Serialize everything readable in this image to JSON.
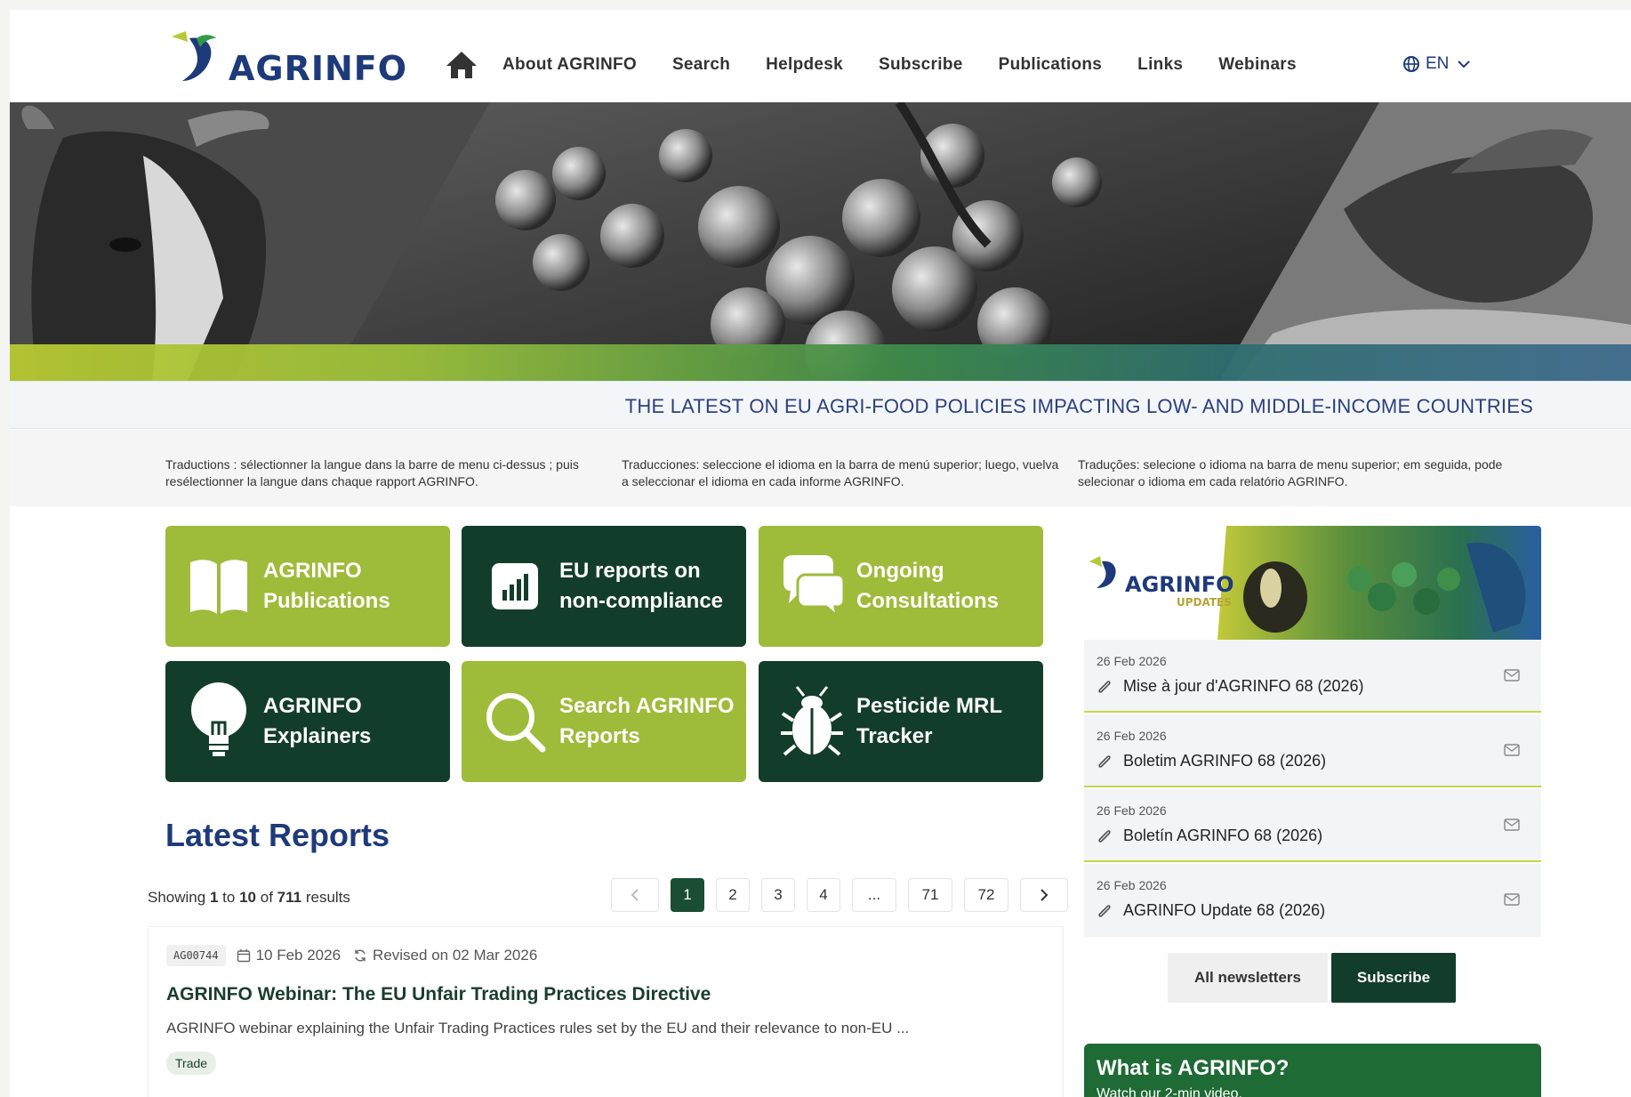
{
  "header": {
    "logo_text": "AGRINFO",
    "nav": [
      "About AGRINFO",
      "Search",
      "Helpdesk",
      "Subscribe",
      "Publications",
      "Links",
      "Webinars"
    ],
    "language": "EN"
  },
  "tagline": "THE LATEST ON EU AGRI-FOOD POLICIES IMPACTING LOW- AND MIDDLE-INCOME COUNTRIES",
  "translations": {
    "fr": "Traductions : sélectionner la langue dans la barre de menu ci-dessus ; puis resélectionner la langue dans chaque rapport AGRINFO.",
    "es": "Traducciones: seleccione el idioma en la barra de menú superior; luego, vuelva a seleccionar el idioma en cada informe AGRINFO.",
    "pt": "Traduções: selecione o idioma na barra de menu superior; em seguida, pode selecionar o idioma em cada relatório AGRINFO."
  },
  "tiles": [
    {
      "line1": "AGRINFO",
      "line2": "Publications",
      "icon": "book-icon",
      "style": "green"
    },
    {
      "line1": "EU reports on",
      "line2": "non-compliance",
      "icon": "bar-chart-icon",
      "style": "dark"
    },
    {
      "line1": "Ongoing",
      "line2": "Consultations",
      "icon": "chat-bubbles-icon",
      "style": "green"
    },
    {
      "line1": "AGRINFO",
      "line2": "Explainers",
      "icon": "lightbulb-icon",
      "style": "dark"
    },
    {
      "line1": "Search AGRINFO",
      "line2": "Reports",
      "icon": "magnifier-icon",
      "style": "green"
    },
    {
      "line1": "Pesticide MRL",
      "line2": "Tracker",
      "icon": "bug-icon",
      "style": "dark"
    }
  ],
  "latest": {
    "title": "Latest Reports",
    "showing_prefix": "Showing",
    "from": "1",
    "to_word": "to",
    "to": "10",
    "of_word": "of",
    "total": "711",
    "results_word": "results",
    "pages": [
      "1",
      "2",
      "3",
      "4",
      "...",
      "71",
      "72"
    ]
  },
  "report": {
    "id": "AG00744",
    "date": "10 Feb 2026",
    "revised": "Revised on 02 Mar 2026",
    "title": "AGRINFO Webinar: The EU Unfair Trading Practices Directive",
    "description": "AGRINFO webinar explaining the Unfair Trading Practices rules set by the EU and their relevance to non-EU ...",
    "tag": "Trade"
  },
  "updates": {
    "banner_title": "AGRINFO",
    "banner_sub": "UPDATES",
    "items": [
      {
        "date": "26 Feb 2026",
        "title": "Mise à jour d'AGRINFO 68 (2026)"
      },
      {
        "date": "26 Feb 2026",
        "title": "Boletim AGRINFO 68 (2026)"
      },
      {
        "date": "26 Feb 2026",
        "title": "Boletín AGRINFO 68 (2026)"
      },
      {
        "date": "26 Feb 2026",
        "title": "AGRINFO Update 68 (2026)"
      }
    ],
    "all_label": "All newsletters",
    "subscribe_label": "Subscribe"
  },
  "what": {
    "title": "What is AGRINFO?",
    "subtitle": "Watch our 2-min video."
  },
  "colors": {
    "brand_blue": "#1e3a7a",
    "tile_green": "#9fbb3a",
    "tile_dark": "#133d2b",
    "accent_green": "#1f6b36"
  }
}
